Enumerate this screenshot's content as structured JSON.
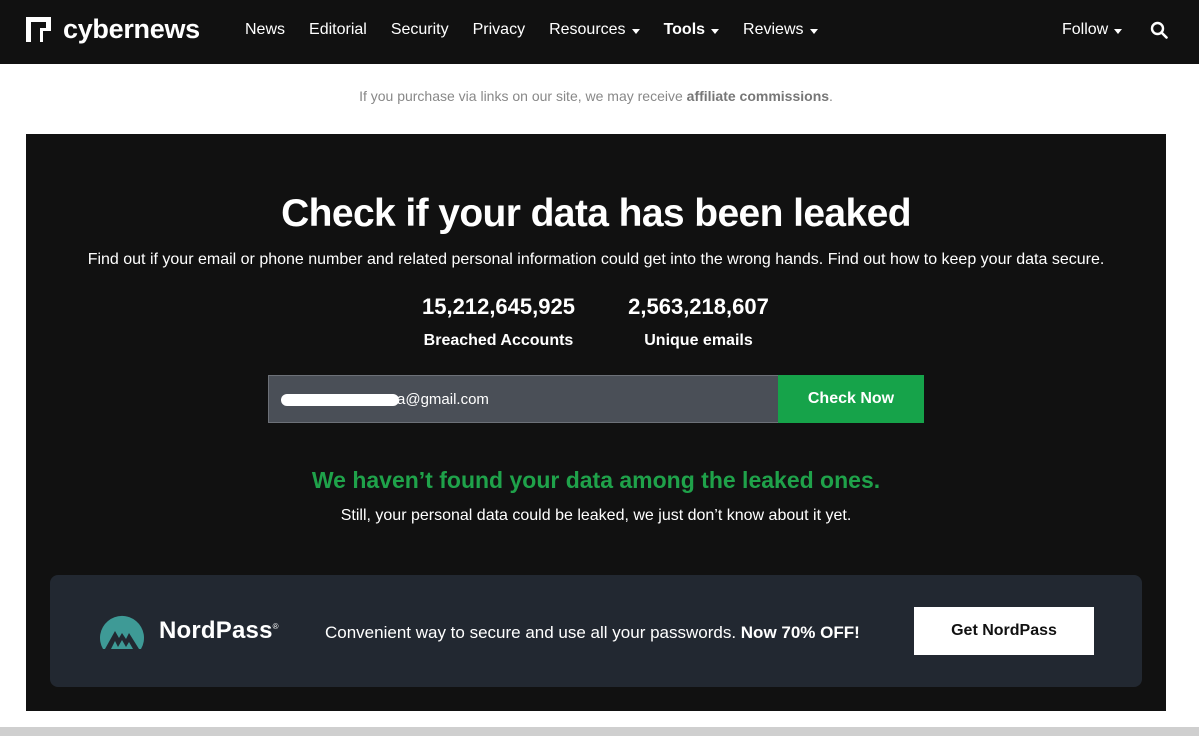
{
  "brand": {
    "name": "cybernews"
  },
  "nav": {
    "items": [
      {
        "label": "News",
        "dropdown": false,
        "bold": false
      },
      {
        "label": "Editorial",
        "dropdown": false,
        "bold": false
      },
      {
        "label": "Security",
        "dropdown": false,
        "bold": false
      },
      {
        "label": "Privacy",
        "dropdown": false,
        "bold": false
      },
      {
        "label": "Resources",
        "dropdown": true,
        "bold": false
      },
      {
        "label": "Tools",
        "dropdown": true,
        "bold": true
      },
      {
        "label": "Reviews",
        "dropdown": true,
        "bold": false
      }
    ],
    "follow_label": "Follow",
    "search_icon": "search-icon"
  },
  "affiliate": {
    "text": "If you purchase via links on our site, we may receive ",
    "bold": "affiliate commissions",
    "end": "."
  },
  "checker": {
    "title": "Check if your data has been leaked",
    "subtitle": "Find out if your email or phone number and related personal information could get into the wrong hands. Find out how to keep your data secure.",
    "stats": [
      {
        "value": "15,212,645,925",
        "label": "Breached Accounts"
      },
      {
        "value": "2,563,218,607",
        "label": "Unique emails"
      }
    ],
    "input_value_visible": "a@gmail.com",
    "button_label": "Check Now",
    "result_title": "We haven’t found your data among the leaked ones.",
    "result_sub": "Still, your personal data could be leaked, we just don’t know about it yet."
  },
  "promo": {
    "brand": "NordPass",
    "text": "Convenient way to secure and use all your passwords. ",
    "text_bold": "Now 70% OFF!",
    "button_label": "Get NordPass"
  },
  "colors": {
    "nav_bg": "#111111",
    "accent_green": "#16a34a",
    "result_green": "#1fa24a",
    "promo_bg": "#222831",
    "nordpass_teal": "#3e9a96"
  }
}
